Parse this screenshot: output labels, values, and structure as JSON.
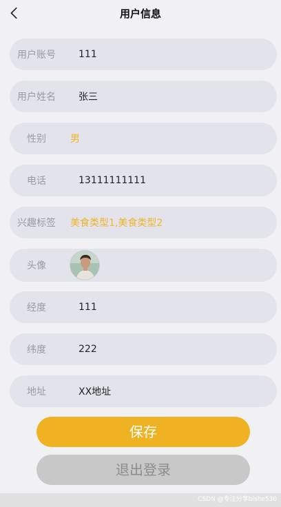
{
  "header": {
    "title": "用户信息"
  },
  "fields": {
    "account": {
      "label": "用户账号",
      "value": "111"
    },
    "name": {
      "label": "用户姓名",
      "value": "张三"
    },
    "gender": {
      "label": "性别",
      "value": "男"
    },
    "phone": {
      "label": "电话",
      "value": "13111111111"
    },
    "interests": {
      "label": "兴趣标签",
      "value": "美食类型1,美食类型2"
    },
    "avatar": {
      "label": "头像"
    },
    "longitude": {
      "label": "经度",
      "value": "111"
    },
    "latitude": {
      "label": "纬度",
      "value": "222"
    },
    "address": {
      "label": "地址",
      "value": "XX地址"
    }
  },
  "actions": {
    "save_label": "保存",
    "logout_label": "退出登录"
  },
  "watermark": "CSDN @专注分享bishe530",
  "colors": {
    "accent": "#efb223",
    "row_bg": "#e3e3ec",
    "page_bg": "#f1f0f3",
    "secondary_button": "#c8c8c8"
  }
}
